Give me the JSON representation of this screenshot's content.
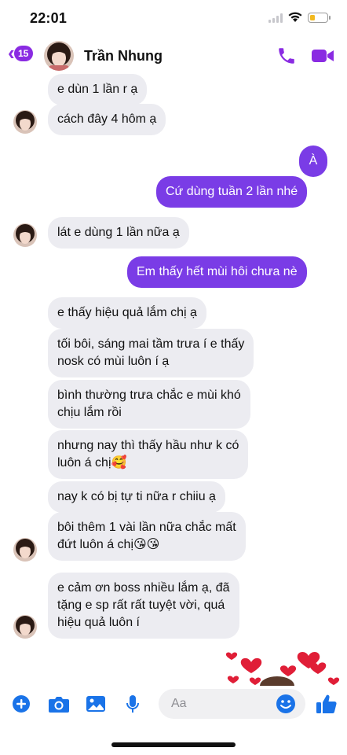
{
  "status": {
    "time": "22:01",
    "battery_level": 0.3
  },
  "header": {
    "back_badge": "15",
    "contact_name": "Trần Nhung",
    "icons": [
      "chevron-left-icon",
      "phone-icon",
      "video-camera-icon"
    ]
  },
  "messages": [
    {
      "from": "them",
      "text": "e dùn 1 lần r ạ"
    },
    {
      "from": "them",
      "text": "cách đây 4 hôm ạ"
    },
    {
      "from": "me",
      "text": "À"
    },
    {
      "from": "me",
      "text": "Cứ dùng tuần 2 lần nhé"
    },
    {
      "from": "them",
      "text": "lát e dùng 1 lần nữa ạ"
    },
    {
      "from": "me",
      "text": "Em thấy hết mùi hôi chưa nè"
    },
    {
      "from": "them",
      "text": "e thấy hiệu quả lắm chị ạ"
    },
    {
      "from": "them",
      "text": "tối bôi, sáng mai tầm trưa í e thấy\nnosk có mùi luôn í ạ"
    },
    {
      "from": "them",
      "text": "bình thường trưa chắc e mùi khó\nchịu lắm rồi"
    },
    {
      "from": "them",
      "text": "nhưng nay thì thấy hầu như k có\nluôn á chị🥰"
    },
    {
      "from": "them",
      "text": "nay k có bị tự ti nữa r chiiu ạ"
    },
    {
      "from": "them",
      "text": "bôi thêm 1 vài lần nữa chắc mất\nđứt luôn á chị😘😘"
    },
    {
      "from": "them",
      "text": "e cảm ơn boss nhiều lắm ạ, đã\ntặng e sp rất rất tuyệt vời, quá\nhiệu quả luôn í"
    }
  ],
  "composer": {
    "placeholder": "Aa",
    "icons": [
      "plus-icon",
      "camera-icon",
      "image-icon",
      "microphone-icon",
      "emoji-icon",
      "thumbs-up-icon"
    ]
  },
  "colors": {
    "accent": "#8a2be2",
    "outgoing_bubble": "#7a3ce6",
    "incoming_bubble": "#ececf1",
    "composer_icons": "#1a73e8"
  }
}
